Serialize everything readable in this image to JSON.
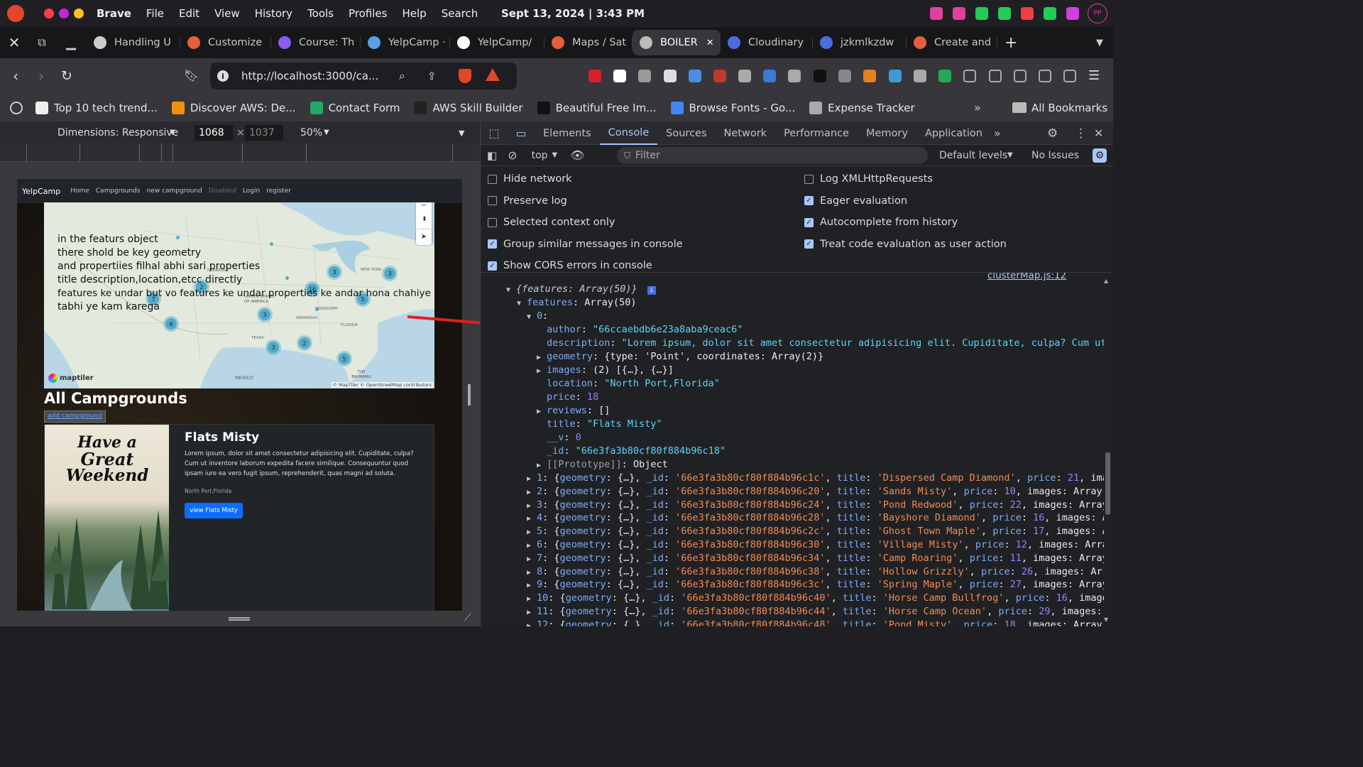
{
  "os": {
    "app_name": "Brave",
    "menus": [
      "File",
      "Edit",
      "View",
      "History",
      "Tools",
      "Profiles",
      "Help",
      "Search"
    ],
    "clock": "Sept 13, 2024 | 3:43 PM",
    "avatar": "PP"
  },
  "tabs": [
    {
      "label": "Handling U",
      "color": "#cccccc"
    },
    {
      "label": "Customize",
      "color": "#e55f3c"
    },
    {
      "label": "Course: Th",
      "color": "#8a5cf0"
    },
    {
      "label": "YelpCamp ·",
      "color": "#5aa0e0"
    },
    {
      "label": "YelpCamp/",
      "color": "#ffffff"
    },
    {
      "label": "Maps / Sat",
      "color": "#e55f3c"
    },
    {
      "label": "BOILER",
      "color": "#bbbbbb",
      "active": true
    },
    {
      "label": "Cloudinary",
      "color": "#4a6ee0"
    },
    {
      "label": "jzkmlkzdw",
      "color": "#4a6ee0"
    },
    {
      "label": "Create and",
      "color": "#e55f3c"
    }
  ],
  "nav": {
    "url": "http://localhost:3000/ca..."
  },
  "bookmarks": [
    {
      "label": "Top 10 tech trend...",
      "color": "#eeeeee"
    },
    {
      "label": "Discover AWS: De...",
      "color": "#f29111"
    },
    {
      "label": "Contact Form",
      "color": "#22aa66"
    },
    {
      "label": "AWS Skill Builder",
      "color": "#222222"
    },
    {
      "label": "Beautiful Free Im...",
      "color": "#111111"
    },
    {
      "label": "Browse Fonts - Go...",
      "color": "#4285f4"
    },
    {
      "label": "Expense Tracker",
      "color": "#aaaaaa"
    }
  ],
  "bookmarks_more": "All Bookmarks",
  "device": {
    "dimensions": "Dimensions: Responsive",
    "width": "1068",
    "x": "×",
    "height": "1037",
    "zoom": "50%"
  },
  "site": {
    "brand": "YelpCamp",
    "nav": [
      "Home",
      "Campgrounds",
      "new campground",
      "Disabled",
      "Login",
      "register"
    ],
    "notes": [
      "in the featurs object",
      "there shold be key geometry",
      "and propertiies filhal abhi sari properties",
      "title description,location,etcc directly",
      "features ke undar but vo features ke undar properties ke andar hona chahiye",
      "tabhi ye kam karega"
    ],
    "clusters": [
      "2",
      "3",
      "3",
      "16",
      "5",
      "7",
      "6",
      "3",
      "3",
      "2",
      "5"
    ],
    "map_labels": [
      "NEBRASKA",
      "UNITED STATES OF AMERICA",
      "NEW YORK",
      "MISSISSIPPI",
      "TEXAS",
      "ARKANSAS",
      "FLORIDA",
      "MEXICO",
      "THE BAHAMAS"
    ],
    "map_credit": "© MapTiler © OpenStreetMap contributors",
    "maptiler": "maptiler",
    "heading": "All Campgrounds",
    "add_link": "add campground",
    "card": {
      "poster_lines": [
        "Have a",
        "Great",
        "Weekend"
      ],
      "title": "Flats Misty",
      "body": "Lorem ipsum, dolor sit amet consectetur adipisicing elit. Cupiditate, culpa? Cum ut inventore laborum expedita facere similique. Consequuntur quod ipsam iure ea vero fugit ipsum, reprehenderit, quas magni ad soluta.",
      "location": "North Port,Florida",
      "button": "view Flats Misty"
    }
  },
  "devtools": {
    "tabs": [
      "Elements",
      "Console",
      "Sources",
      "Network",
      "Performance",
      "Memory",
      "Application"
    ],
    "context": "top",
    "filter_placeholder": "Filter",
    "levels": "Default levels",
    "issues": "No Issues",
    "settings_left": [
      {
        "label": "Hide network",
        "on": false
      },
      {
        "label": "Preserve log",
        "on": false
      },
      {
        "label": "Selected context only",
        "on": false
      },
      {
        "label": "Group similar messages in console",
        "on": true
      },
      {
        "label": "Show CORS errors in console",
        "on": true
      }
    ],
    "settings_right": [
      {
        "label": "Log XMLHttpRequests",
        "on": false
      },
      {
        "label": "Eager evaluation",
        "on": true
      },
      {
        "label": "Autocomplete from history",
        "on": true
      },
      {
        "label": "Treat code evaluation as user action",
        "on": true
      }
    ],
    "source_link": "clusterMap.js:12",
    "obj_summary": "{features: Array(50)}",
    "features_label": "features",
    "features_type": "Array(50)",
    "item0": {
      "author": "\"66ccaebdb6e23a8aba9ceac6\"",
      "description": "\"Lorem ipsum, dolor sit amet consectetur adipisicing elit. Cupiditate, culpa? Cum ut",
      "geometry": "{type: 'Point', coordinates: Array(2)}",
      "images": "(2) [{…}, {…}]",
      "location": "\"North Port,Florida\"",
      "price": "18",
      "reviews": "[]",
      "title": "\"Flats Misty\"",
      "v": "0",
      "id": "\"66e3fa3b80cf80f884b96c18\"",
      "proto": "Object"
    },
    "rows": [
      {
        "i": "1",
        "id": "'66e3fa3b80cf80f884b96c1c'",
        "title": "'Dispersed Camp Diamond'",
        "price": "21",
        "tail": "ima"
      },
      {
        "i": "2",
        "id": "'66e3fa3b80cf80f884b96c20'",
        "title": "'Sands Misty'",
        "price": "10",
        "tail": "images: Array("
      },
      {
        "i": "3",
        "id": "'66e3fa3b80cf80f884b96c24'",
        "title": "'Pond Redwood'",
        "price": "22",
        "tail": "images: Array"
      },
      {
        "i": "4",
        "id": "'66e3fa3b80cf80f884b96c28'",
        "title": "'Bayshore Diamond'",
        "price": "16",
        "tail": "images: A"
      },
      {
        "i": "5",
        "id": "'66e3fa3b80cf80f884b96c2c'",
        "title": "'Ghost Town Maple'",
        "price": "17",
        "tail": "images: A"
      },
      {
        "i": "6",
        "id": "'66e3fa3b80cf80f884b96c30'",
        "title": "'Village Misty'",
        "price": "12",
        "tail": "images: Arra"
      },
      {
        "i": "7",
        "id": "'66e3fa3b80cf80f884b96c34'",
        "title": "'Camp Roaring'",
        "price": "11",
        "tail": "images: Array"
      },
      {
        "i": "8",
        "id": "'66e3fa3b80cf80f884b96c38'",
        "title": "'Hollow Grizzly'",
        "price": "26",
        "tail": "images: Arr"
      },
      {
        "i": "9",
        "id": "'66e3fa3b80cf80f884b96c3c'",
        "title": "'Spring Maple'",
        "price": "27",
        "tail": "images: Array"
      },
      {
        "i": "10",
        "id": "'66e3fa3b80cf80f884b96c40'",
        "title": "'Horse Camp Bullfrog'",
        "price": "16",
        "tail": "image"
      },
      {
        "i": "11",
        "id": "'66e3fa3b80cf80f884b96c44'",
        "title": "'Horse Camp Ocean'",
        "price": "29",
        "tail": "images: "
      },
      {
        "i": "12",
        "id": "'66e3fa3b80cf80f884b96c48'",
        "title": "'Pond Misty'",
        "price": "18",
        "tail": "images: Array("
      }
    ]
  }
}
